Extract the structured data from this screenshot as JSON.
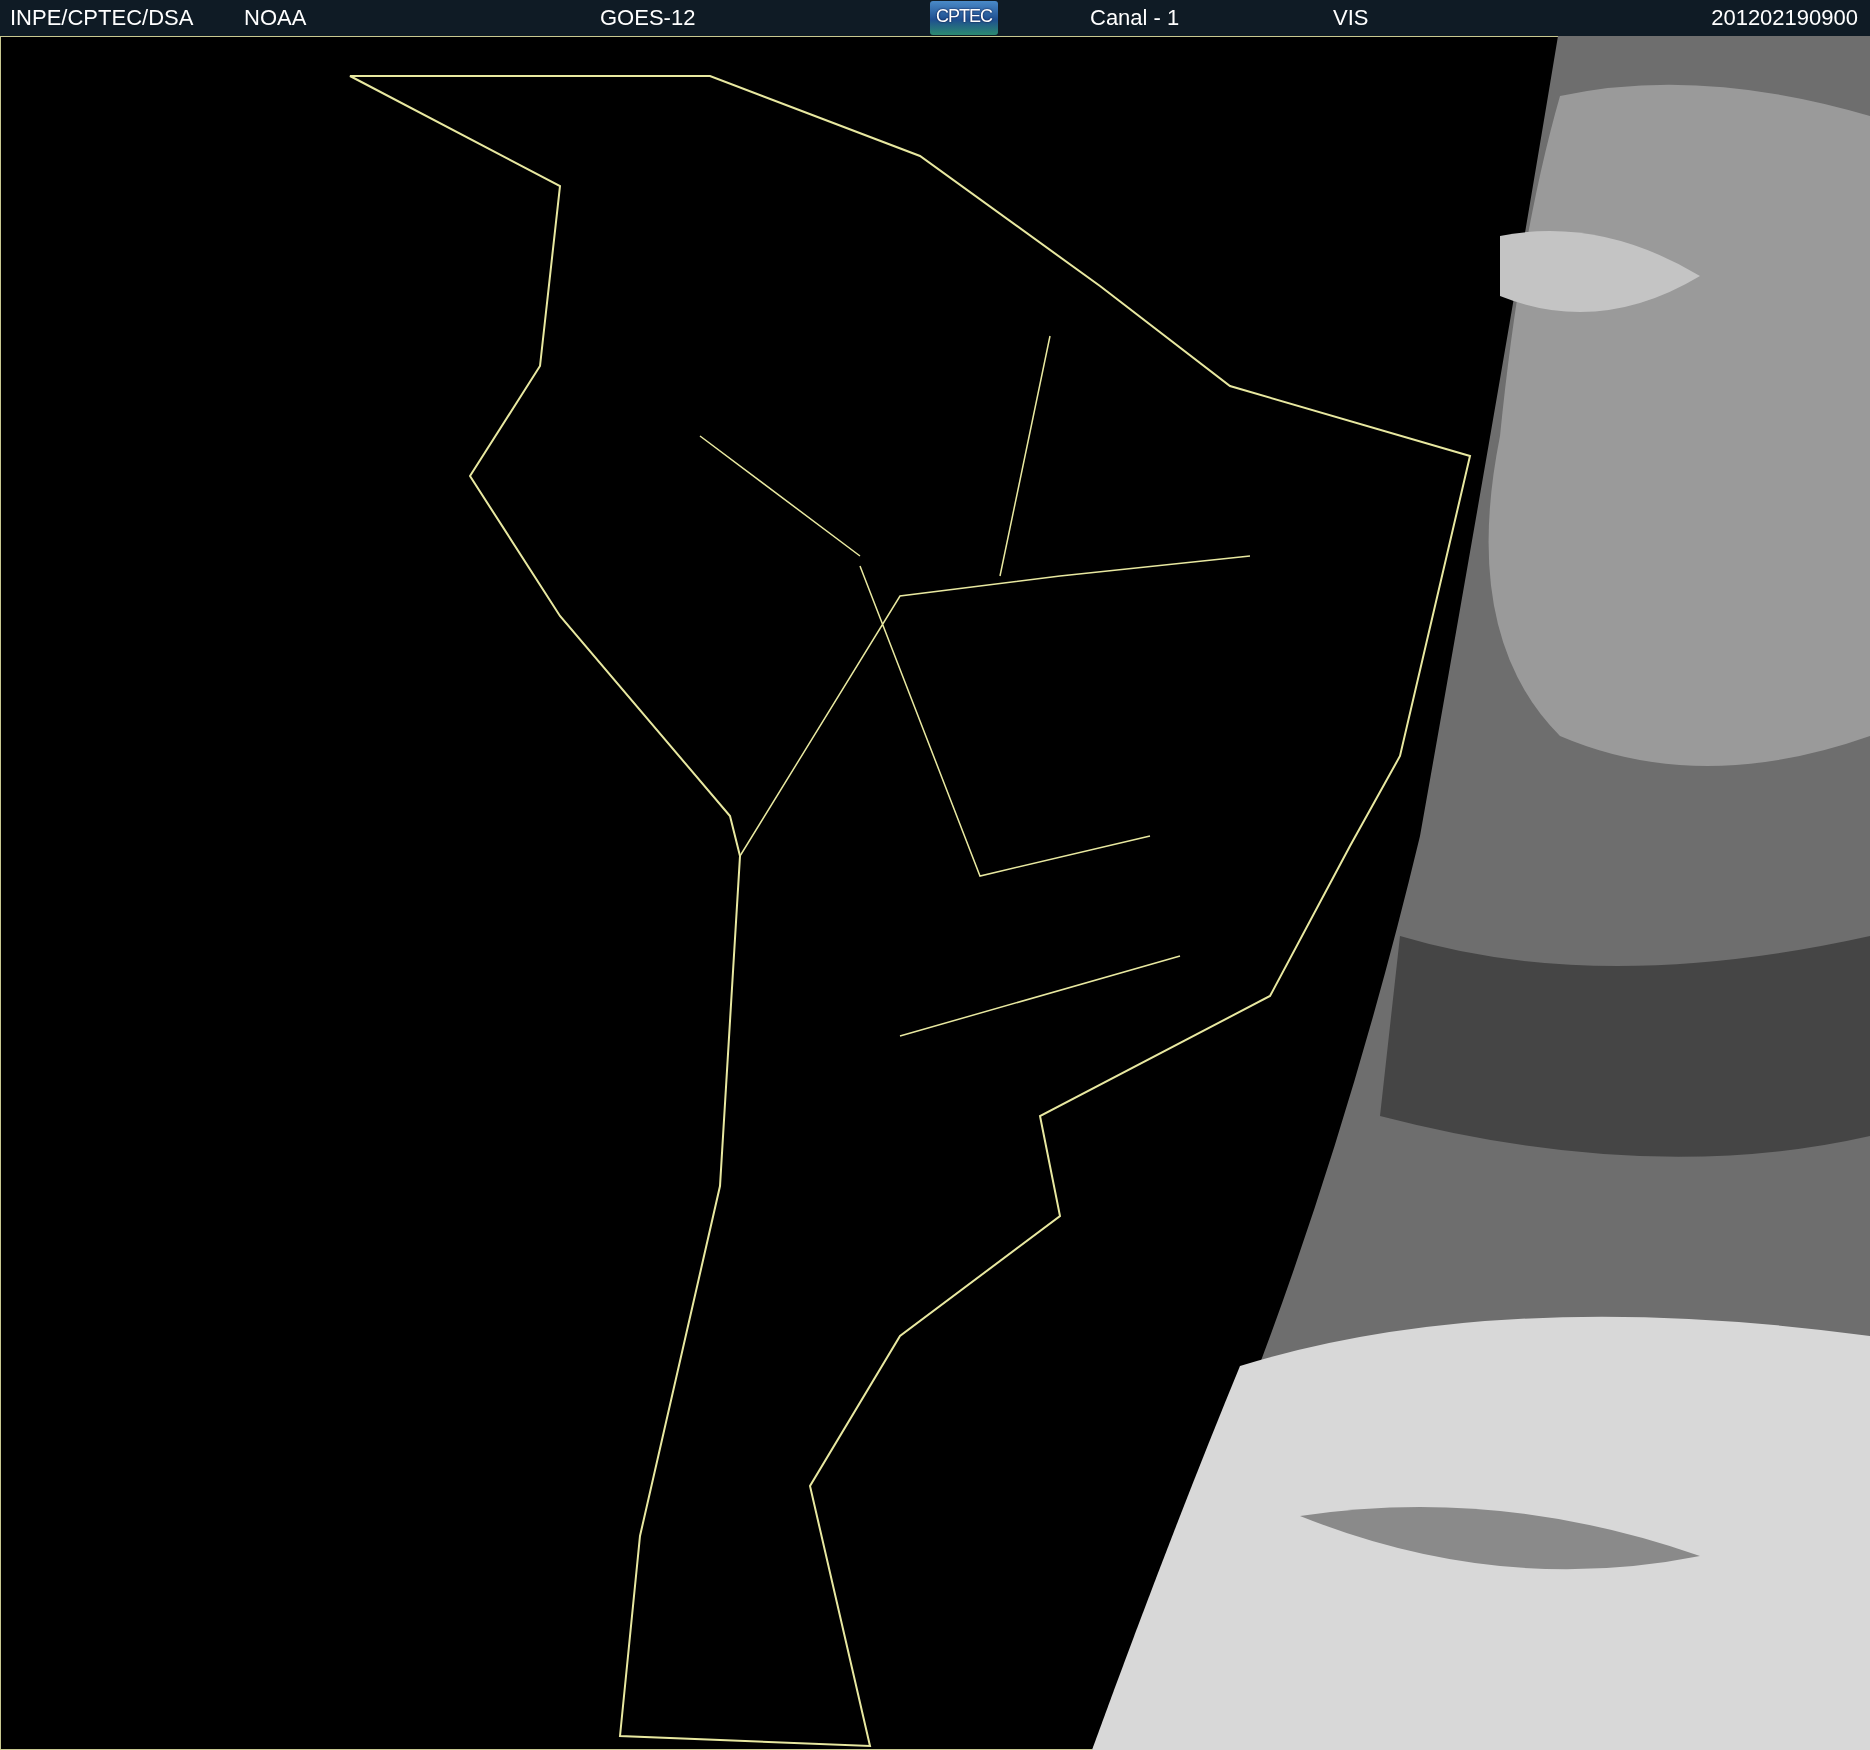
{
  "header": {
    "source": "INPE/CPTEC/DSA",
    "agency": "NOAA",
    "satellite": "GOES-12",
    "logo": "CPTEC",
    "channel": "Canal - 1",
    "band": "VIS",
    "timestamp": "201202190900"
  }
}
